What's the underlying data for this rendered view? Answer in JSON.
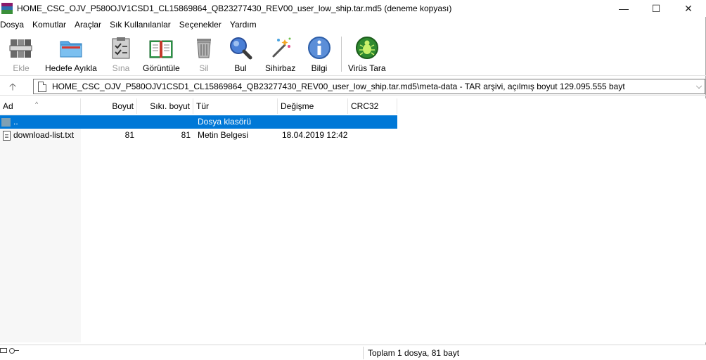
{
  "window": {
    "title": "HOME_CSC_OJV_P580OJV1CSD1_CL15869864_QB23277430_REV00_user_low_ship.tar.md5 (deneme kopyası)",
    "min_glyph": "—",
    "max_glyph": "☐",
    "close_glyph": "✕"
  },
  "menu": [
    "Dosya",
    "Komutlar",
    "Araçlar",
    "Sık Kullanılanlar",
    "Seçenekler",
    "Yardım"
  ],
  "toolbar": {
    "ekle": "Ekle",
    "hedefe": "Hedefe Ayıkla",
    "sina": "Sına",
    "goruntule": "Görüntüle",
    "sil": "Sil",
    "bul": "Bul",
    "sihirbaz": "Sihirbaz",
    "bilgi": "Bilgi",
    "virus": "Virüs Tara"
  },
  "address": {
    "up_glyph": "🡡",
    "path": "HOME_CSC_OJV_P580OJV1CSD1_CL15869864_QB23277430_REV00_user_low_ship.tar.md5\\meta-data - TAR arşivi, açılmış boyut 129.095.555 bayt",
    "dropdown_glyph": "⌵"
  },
  "columns": {
    "ad": "Ad",
    "boyut": "Boyut",
    "siki": "Sıkı. boyut",
    "tur": "Tür",
    "degisme": "Değişme",
    "crc": "CRC32",
    "sort_glyph": "^"
  },
  "rows": [
    {
      "name": "..",
      "size": "",
      "packed": "",
      "type": "Dosya klasörü",
      "modified": "",
      "crc": ""
    },
    {
      "name": "download-list.txt",
      "size": "81",
      "packed": "81",
      "type": "Metin Belgesi",
      "modified": "18.04.2019 12:42",
      "crc": ""
    }
  ],
  "status": {
    "text": "Toplam 1 dosya, 81 bayt"
  },
  "colors": {
    "selection": "#0078d7",
    "folder": "#7fa0b4"
  }
}
